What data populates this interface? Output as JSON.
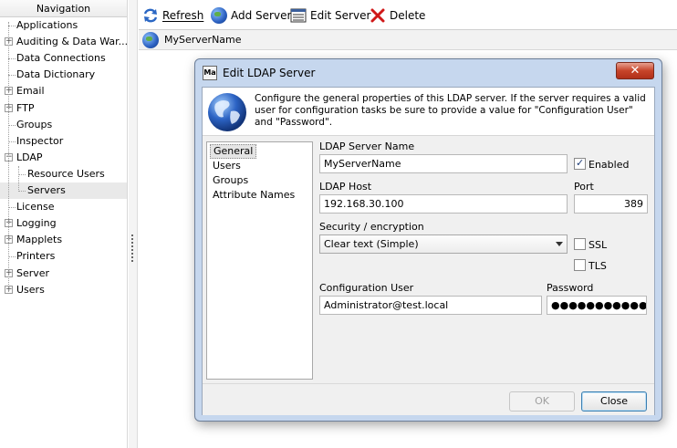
{
  "navigation": {
    "title": "Navigation",
    "items": [
      {
        "label": "Applications",
        "expandable": false
      },
      {
        "label": "Auditing & Data War...",
        "expandable": true
      },
      {
        "label": "Data Connections",
        "expandable": false
      },
      {
        "label": "Data Dictionary",
        "expandable": false
      },
      {
        "label": "Email",
        "expandable": true
      },
      {
        "label": "FTP",
        "expandable": true
      },
      {
        "label": "Groups",
        "expandable": false
      },
      {
        "label": "Inspector",
        "expandable": false
      },
      {
        "label": "LDAP",
        "expandable": true,
        "expanded": true
      },
      {
        "label": "Resource Users",
        "expandable": false,
        "child": true
      },
      {
        "label": "Servers",
        "expandable": false,
        "child": true,
        "selected": true
      },
      {
        "label": "License",
        "expandable": false
      },
      {
        "label": "Logging",
        "expandable": true
      },
      {
        "label": "Mapplets",
        "expandable": true
      },
      {
        "label": "Printers",
        "expandable": false
      },
      {
        "label": "Server",
        "expandable": true
      },
      {
        "label": "Users",
        "expandable": true
      }
    ]
  },
  "toolbar": {
    "refresh_label": "Refresh",
    "add_server_label": "Add Server",
    "edit_server_label": "Edit Server",
    "delete_label": "Delete"
  },
  "servers": [
    {
      "name": "MyServerName"
    }
  ],
  "dialog": {
    "title": "Edit LDAP Server",
    "app_icon_text": "Ma",
    "close_glyph": "✕",
    "description": "Configure the general properties of this LDAP server.  If the server requires a valid user for configuration tasks be sure to provide a value for \"Configuration User\" and \"Password\".",
    "tabs": [
      "General",
      "Users",
      "Groups",
      "Attribute Names"
    ],
    "selected_tab": "General",
    "fields": {
      "server_name_label": "LDAP Server Name",
      "server_name_value": "MyServerName",
      "enabled_label": "Enabled",
      "enabled_checked": true,
      "host_label": "LDAP Host",
      "host_value": "192.168.30.100",
      "port_label": "Port",
      "port_value": "389",
      "security_label": "Security / encryption",
      "security_value": "Clear text (Simple)",
      "ssl_label": "SSL",
      "ssl_checked": false,
      "tls_label": "TLS",
      "tls_checked": false,
      "config_user_label": "Configuration User",
      "config_user_value": "Administrator@test.local",
      "password_label": "Password",
      "password_value": "●●●●●●●●●●●●●"
    },
    "ok_label": "OK",
    "close_label": "Close"
  },
  "colors": {
    "dialog_frame": "#c6d7ee",
    "close_button": "#c7442a",
    "default_button_border": "#3c7fb1"
  }
}
